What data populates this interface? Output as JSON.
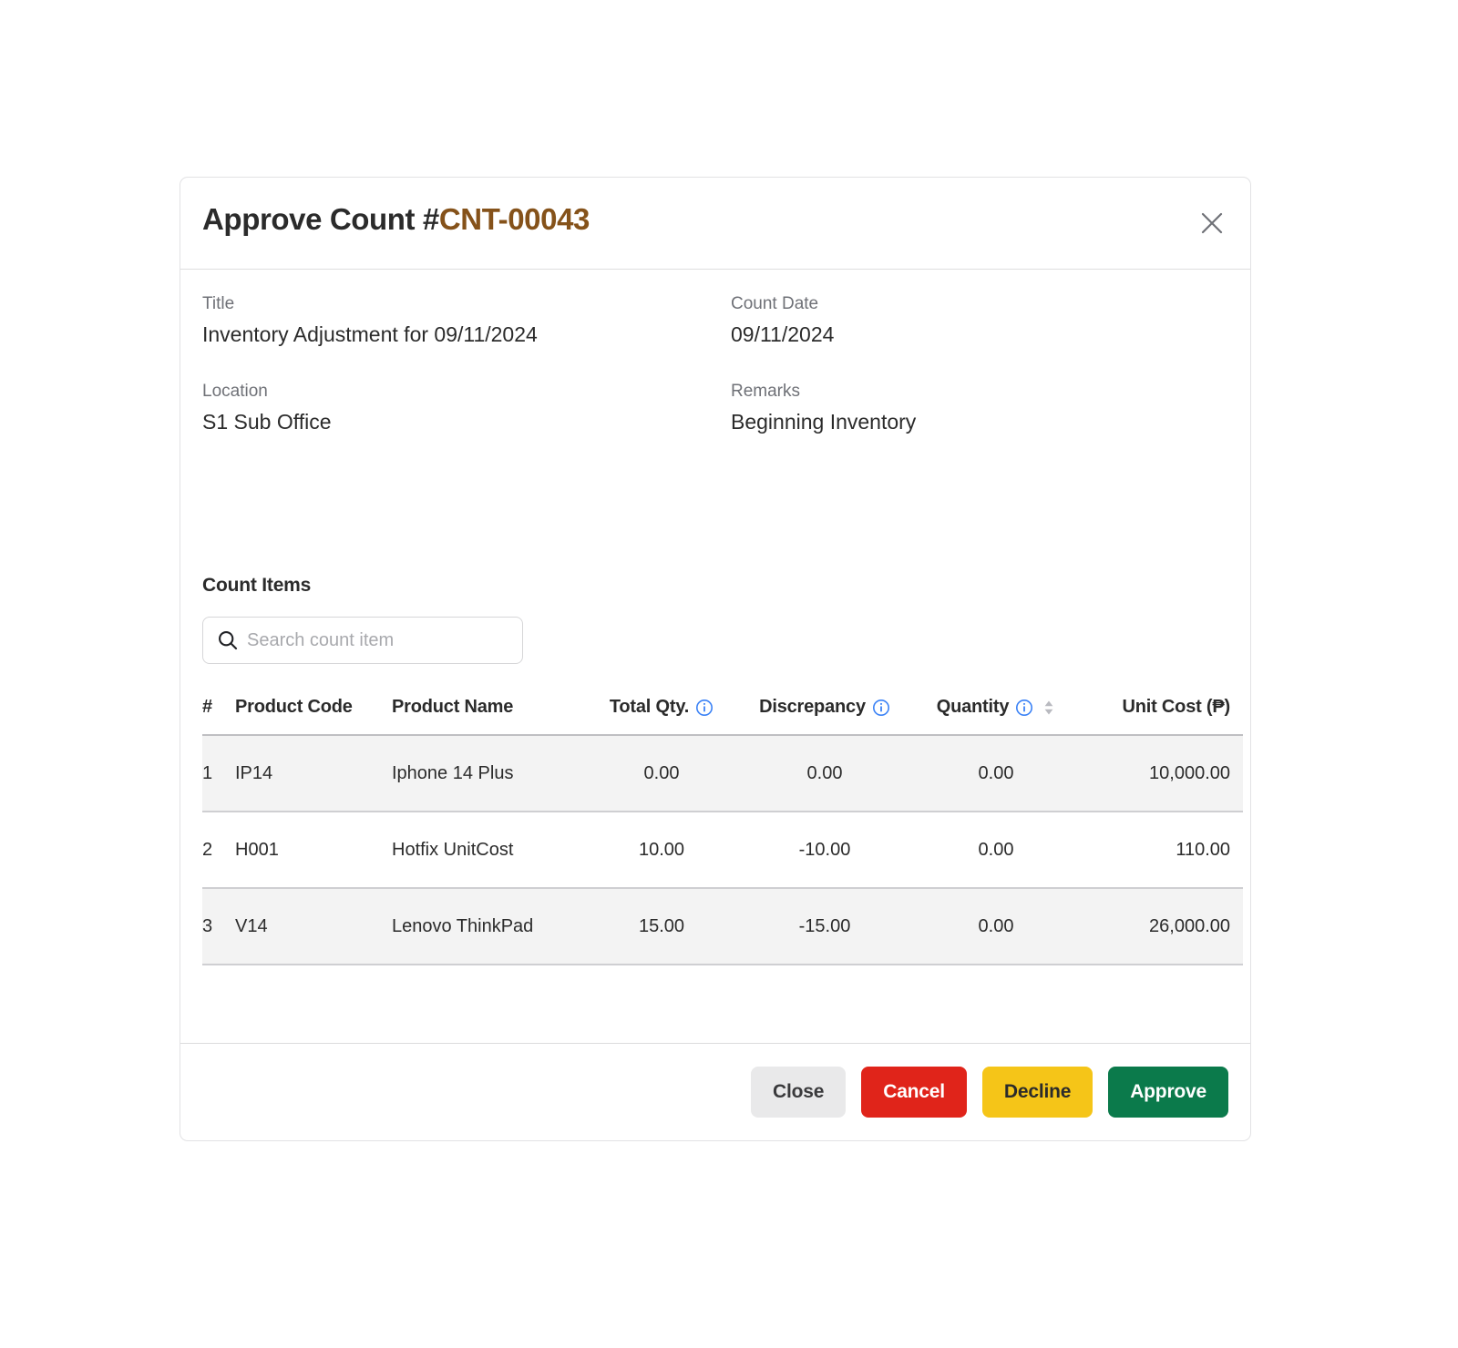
{
  "dialog": {
    "title_prefix": "Approve Count #",
    "title_reference": "CNT-00043",
    "close_icon": "close-icon",
    "accent_color": "#85521a"
  },
  "details": {
    "title_label": "Title",
    "title_value": "Inventory Adjustment for 09/11/2024",
    "count_date_label": "Count Date",
    "count_date_value": "09/11/2024",
    "location_label": "Location",
    "location_value": "S1 Sub Office",
    "remarks_label": "Remarks",
    "remarks_value": "Beginning Inventory"
  },
  "count_items": {
    "heading": "Count Items",
    "search": {
      "placeholder": "Search count item",
      "value": "",
      "icon": "search-icon"
    },
    "columns": {
      "num": "#",
      "product_code": "Product Code",
      "product_name": "Product Name",
      "total_qty": "Total Qty.",
      "discrepancy": "Discrepancy",
      "quantity": "Quantity",
      "unit_cost": "Unit Cost (₱)"
    },
    "column_icons": {
      "total_qty_info": "info-icon",
      "discrepancy_info": "info-icon",
      "quantity_info": "info-icon",
      "quantity_sort": "sort-updown-icon"
    },
    "rows": [
      {
        "num": "1",
        "product_code": "IP14",
        "product_name": "Iphone 14 Plus",
        "total_qty": "0.00",
        "discrepancy": "0.00",
        "discrepancy_state": "positive",
        "quantity": "0.00",
        "unit_cost": "10,000.00"
      },
      {
        "num": "2",
        "product_code": "H001",
        "product_name": "Hotfix UnitCost",
        "total_qty": "10.00",
        "discrepancy": "-10.00",
        "discrepancy_state": "negative",
        "quantity": "0.00",
        "unit_cost": "110.00"
      },
      {
        "num": "3",
        "product_code": "V14",
        "product_name": "Lenovo ThinkPad",
        "total_qty": "15.00",
        "discrepancy": "-15.00",
        "discrepancy_state": "negative",
        "quantity": "0.00",
        "unit_cost": "26,000.00"
      }
    ]
  },
  "footer": {
    "close_label": "Close",
    "cancel_label": "Cancel",
    "decline_label": "Decline",
    "approve_label": "Approve",
    "colors": {
      "close_bg": "#e9e9ea",
      "cancel_bg": "#e0241a",
      "decline_bg": "#f5c518",
      "approve_bg": "#0b7a4b",
      "positive_text": "#067647",
      "negative_text": "#e8261a"
    }
  }
}
